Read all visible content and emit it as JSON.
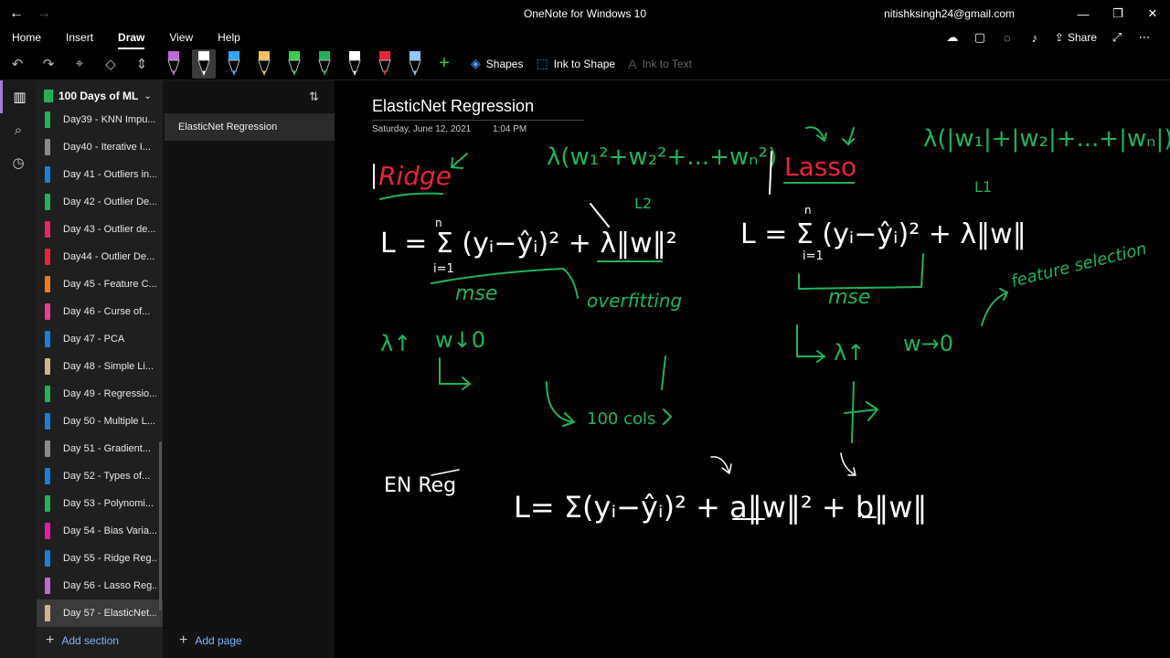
{
  "titlebar": {
    "app_title": "OneNote for Windows 10",
    "account": "nitishksingh24@gmail.com"
  },
  "menu": {
    "tabs": [
      "Home",
      "Insert",
      "Draw",
      "View",
      "Help"
    ],
    "active": "Draw",
    "share_label": "Share"
  },
  "ribbon": {
    "shapes_label": "Shapes",
    "ink_to_shape_label": "Ink to Shape",
    "ink_to_text_label": "Ink to Text",
    "pens": [
      {
        "color": "#c06bd1"
      },
      {
        "color": "#ffffff"
      },
      {
        "color": "#2da8ff"
      },
      {
        "color": "#f5c15a"
      },
      {
        "color": "#33d14a"
      },
      {
        "color": "#1fb45a"
      },
      {
        "color": "#ffffff"
      },
      {
        "color": "#e8233b"
      },
      {
        "color": "#8ec7ff"
      }
    ]
  },
  "notebook": {
    "name": "100 Days of ML",
    "sections": [
      {
        "label": "Day39 - KNN Impu...",
        "color": "#1fb45a"
      },
      {
        "label": "Day40 - Iterative I...",
        "color": "#8a8a8a"
      },
      {
        "label": "Day 41 - Outliers in...",
        "color": "#1a7fd6"
      },
      {
        "label": "Day 42 - Outlier De...",
        "color": "#1fb45a"
      },
      {
        "label": "Day 43 - Outlier de...",
        "color": "#e8236b"
      },
      {
        "label": "Day44 - Outlier De...",
        "color": "#e8233b"
      },
      {
        "label": "Day 45 - Feature C...",
        "color": "#f07a1a"
      },
      {
        "label": "Day 46 - Curse of...",
        "color": "#e83d8e"
      },
      {
        "label": "Day 47 - PCA",
        "color": "#1a7fd6"
      },
      {
        "label": "Day 48 - Simple Li...",
        "color": "#d2b48c"
      },
      {
        "label": "Day 49 - Regressio...",
        "color": "#1fb45a"
      },
      {
        "label": "Day 50 - Multiple L...",
        "color": "#1a7fd6"
      },
      {
        "label": "Day 51 - Gradient...",
        "color": "#8a8a8a"
      },
      {
        "label": "Day 52 - Types of...",
        "color": "#1a7fd6"
      },
      {
        "label": "Day 53 - Polynomi...",
        "color": "#1fb45a"
      },
      {
        "label": "Day 54 - Bias Varia...",
        "color": "#e81aa8"
      },
      {
        "label": "Day 55 - Ridge Reg...",
        "color": "#1a7fd6"
      },
      {
        "label": "Day 56 - Lasso Reg...",
        "color": "#c06bd1"
      },
      {
        "label": "Day 57 - ElasticNet...",
        "color": "#d2b48c"
      }
    ],
    "add_section": "Add section"
  },
  "pages": {
    "items": [
      "ElasticNet Regression"
    ],
    "add_page": "Add page"
  },
  "note": {
    "title": "ElasticNet Regression",
    "date": "Saturday, June 12, 2021",
    "time": "1:04 PM"
  },
  "ink": {
    "ridge": "Ridge",
    "lasso": "Lasso",
    "mse": "mse",
    "overfitting": "overfitting",
    "feature_selection": "feature selection",
    "cols": "100 cols",
    "en_reg": "EN Reg",
    "l2": "L2",
    "l1": "L1"
  }
}
